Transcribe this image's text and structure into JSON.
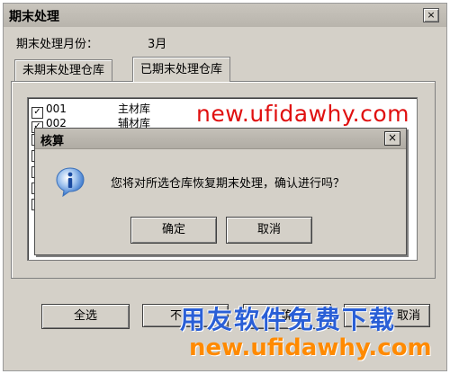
{
  "window": {
    "title": "期末处理",
    "close_glyph": "×"
  },
  "period": {
    "label": "期末处理月份：",
    "value": "3月"
  },
  "tabs": [
    {
      "label": "未期末处理仓库"
    },
    {
      "label": "已期末处理仓库"
    }
  ],
  "warehouses": [
    {
      "checked": "✓",
      "code": "001",
      "name": "主材库"
    },
    {
      "checked": "✓",
      "code": "002",
      "name": "辅材库"
    }
  ],
  "buttons": {
    "select_all": "全选",
    "partial_2": "不",
    "partial_3": "确",
    "partial_4": "取消"
  },
  "dialog": {
    "title": "核算",
    "close_glyph": "×",
    "icon": "info-icon",
    "message": "您将对所选仓库恢复期末处理，确认进行吗？",
    "ok": "确定",
    "cancel": "取消"
  },
  "watermarks": {
    "red": "new.ufidawhy.com",
    "blue": "用友软件免费下载",
    "orange": "new.ufidawhy.com"
  }
}
